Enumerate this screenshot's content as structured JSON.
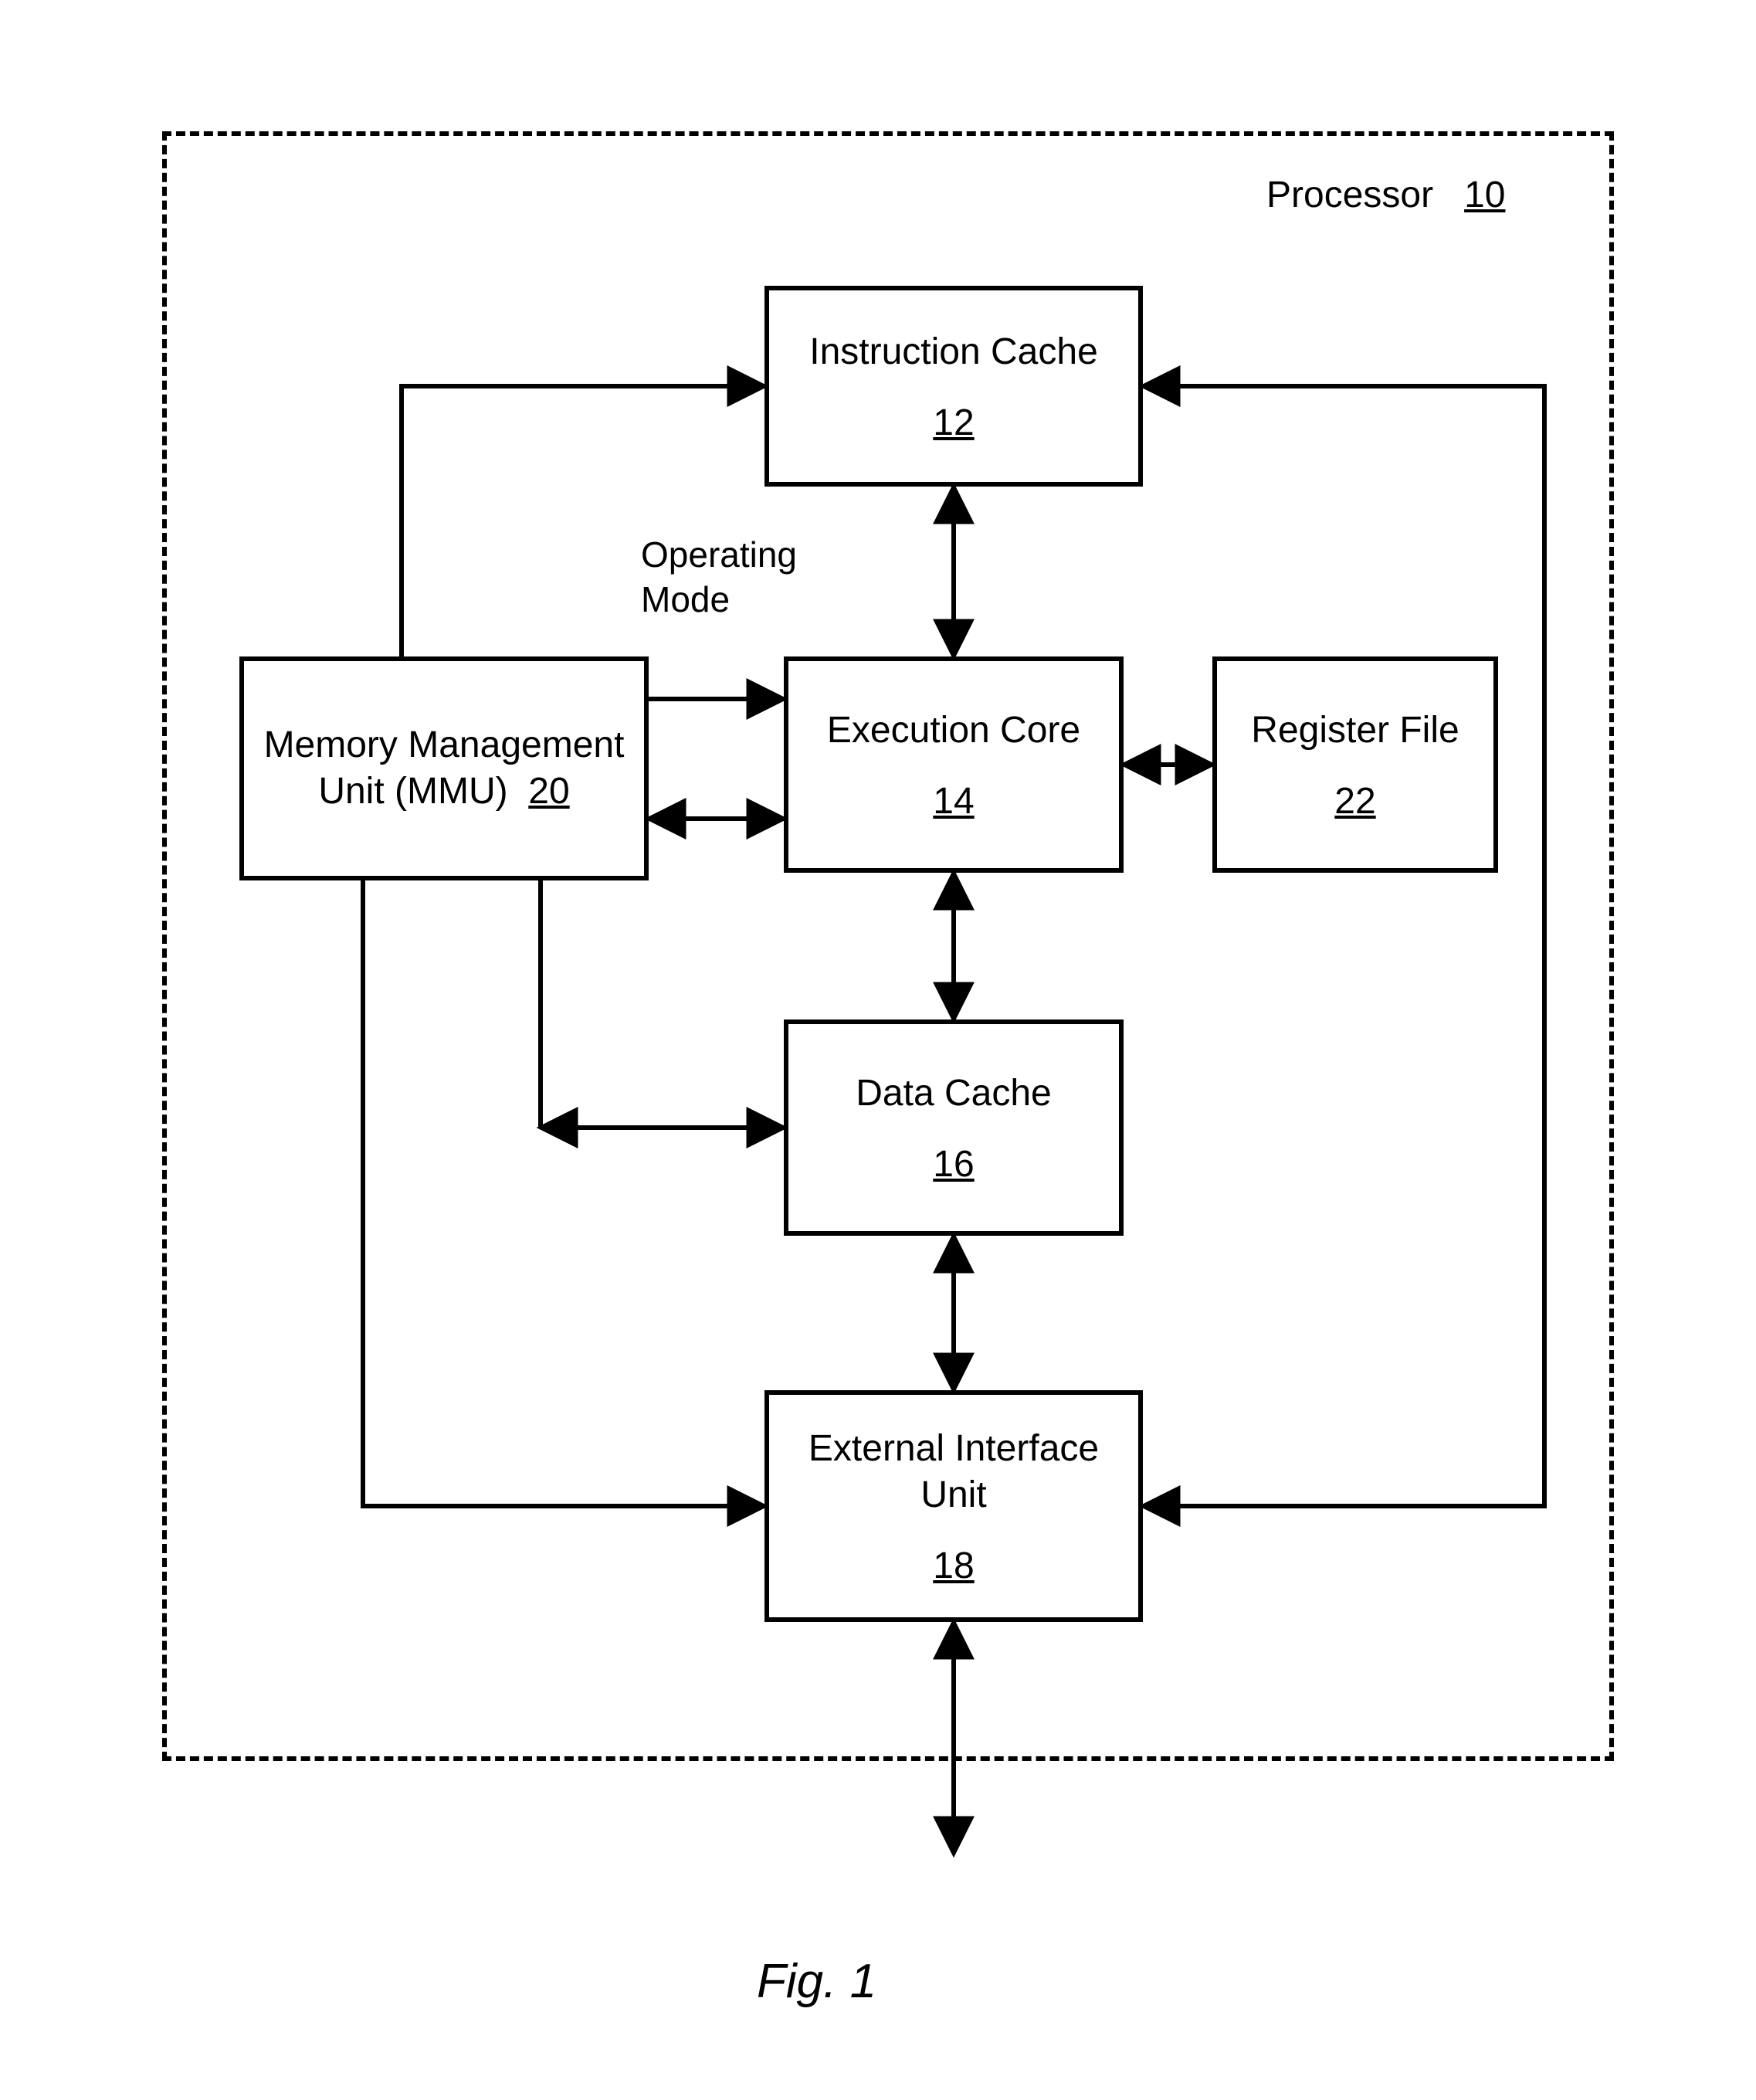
{
  "figure": {
    "caption": "Fig. 1",
    "processor": {
      "label": "Processor",
      "ref": "10"
    },
    "operating_mode_label": "Operating\nMode",
    "blocks": {
      "icache": {
        "label": "Instruction Cache",
        "ref": "12"
      },
      "mmu": {
        "label": "Memory Management\nUnit (MMU)",
        "ref": "20"
      },
      "execcore": {
        "label": "Execution Core",
        "ref": "14"
      },
      "regfile": {
        "label": "Register File",
        "ref": "22"
      },
      "dcache": {
        "label": "Data Cache",
        "ref": "16"
      },
      "extif": {
        "label": "External Interface\nUnit",
        "ref": "18"
      }
    }
  }
}
